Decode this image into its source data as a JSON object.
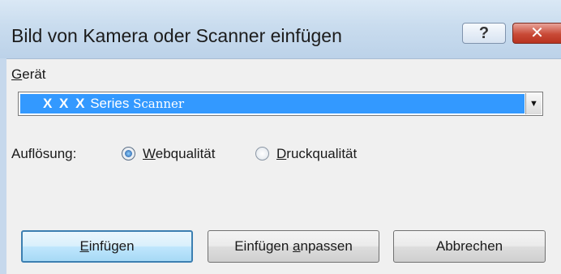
{
  "window": {
    "title": "Bild von Kamera oder Scanner einfügen",
    "help_label": "?",
    "close_label": "✕"
  },
  "device": {
    "label_accel": "G",
    "label_rest": "erät",
    "selected_bold": "X X X",
    "selected_mid": " Series ",
    "selected_end": "Scanner"
  },
  "resolution": {
    "label": "Auflösung:",
    "options": [
      {
        "accel": "W",
        "rest": "ebqualität",
        "selected": true
      },
      {
        "accel": "D",
        "rest": "ruckqualität",
        "selected": false
      }
    ]
  },
  "buttons": {
    "insert_accel": "E",
    "insert_rest": "infügen",
    "custom_pre": "Einfügen ",
    "custom_accel": "a",
    "custom_rest": "npassen",
    "cancel": "Abbrechen"
  },
  "colors": {
    "selection": "#3399ff",
    "titlebar": "#c9dcee",
    "close": "#c94a37"
  }
}
